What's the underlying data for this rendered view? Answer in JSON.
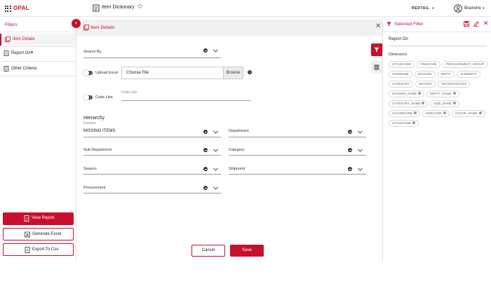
{
  "app": {
    "brand": "OPAL",
    "page_title": "Item Dictionary",
    "tenant": "REDTAG.",
    "user": "Brainvire"
  },
  "sidebar": {
    "title": "Filters",
    "items": [
      {
        "label": "Item Details",
        "active": true
      },
      {
        "label": "Report On",
        "has_status_dot": true
      },
      {
        "label": "Other Criteria"
      }
    ],
    "actions": {
      "view_report": "View Report",
      "generate_excel": "Generate Excel",
      "export_csv": "Export To Csv"
    }
  },
  "main": {
    "title": "Item Details",
    "search_by": {
      "label": "Search By",
      "value": ""
    },
    "upload_excel": {
      "label": "Upload Excel",
      "file_placeholder": "Choose File",
      "browse": "Browse"
    },
    "code_like": {
      "label": "Code Like",
      "field_label": "Code Like",
      "value": ""
    },
    "hierarchy": {
      "title": "Hierarchy",
      "subtitle": "Division",
      "division_value": "MISSING ITEMS",
      "department": "Department",
      "sub_department": "Sub Department",
      "category": "Category",
      "season": "Season",
      "shipment": "Shipment",
      "procurement": "Procurement"
    },
    "buttons": {
      "cancel": "Cancel",
      "save": "Save"
    }
  },
  "selected_filter": {
    "title": "Selected Filter",
    "report_on": "Report On",
    "dimensions_label": "Dimensions",
    "chips": [
      {
        "label": "STYLECODE"
      },
      {
        "label": "ITEMCODE"
      },
      {
        "label": "PROCUREMENT_GROUP"
      },
      {
        "label": "ITEMNAME"
      },
      {
        "label": "DIVISION"
      },
      {
        "label": "DEPTT"
      },
      {
        "label": "SUBDEPTT"
      },
      {
        "label": "CATEGORY"
      },
      {
        "label": "SEASON"
      },
      {
        "label": "YEARSCHEDULE"
      },
      {
        "label": "DIVISION_NAME",
        "removable": true
      },
      {
        "label": "DEPTT_NAME",
        "removable": true
      },
      {
        "label": "CATEGORY_NAME",
        "removable": true
      },
      {
        "label": "SIZE_NAME",
        "removable": true
      },
      {
        "label": "COLORCODE",
        "removable": true
      },
      {
        "label": "SIZECODE",
        "removable": true
      },
      {
        "label": "COLOR_NAME",
        "removable": true
      },
      {
        "label": "STYLENAME",
        "removable": true
      }
    ]
  },
  "colors": {
    "accent": "#c8102e",
    "status_green": "#1aa34a"
  }
}
